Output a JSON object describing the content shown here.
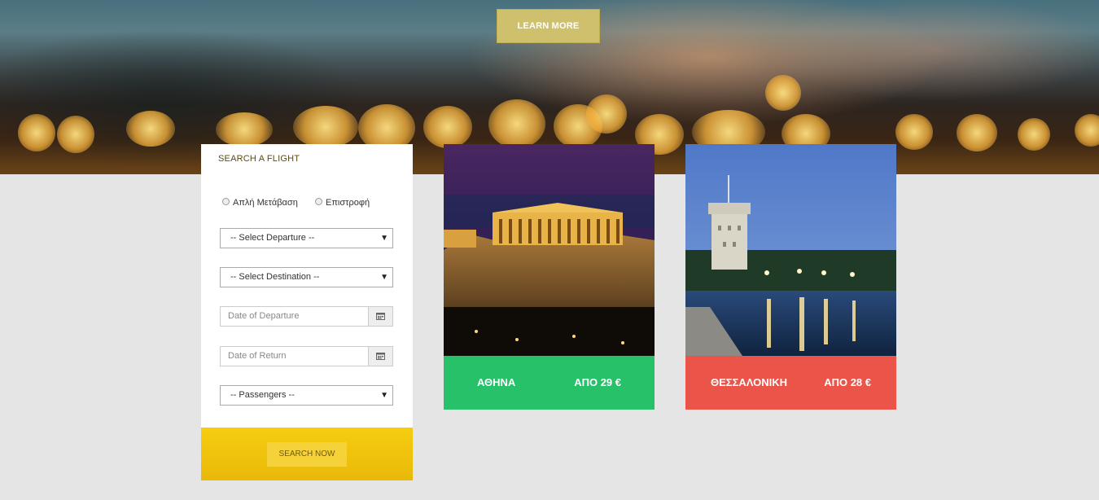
{
  "hero": {
    "learn_more_label": "LEARN MORE"
  },
  "search": {
    "title": "SEARCH A FLIGHT",
    "trip_types": [
      "Απλή Μετάβαση",
      "Επιστροφή"
    ],
    "departure_select": "-- Select Departure --",
    "destination_select": "-- Select Destination --",
    "departure_date_placeholder": "Date of Departure",
    "return_date_placeholder": "Date of Return",
    "passengers_select": "-- Passengers --",
    "submit_label": "SEARCH NOW"
  },
  "destinations": [
    {
      "name": "ΑΘΗΝΑ",
      "price": "ΑΠΟ 29 €",
      "color": "#27c16a"
    },
    {
      "name": "ΘΕΣΣΑΛΟΝΙΚΗ",
      "price": "ΑΠΟ 28 €",
      "color": "#ea5449"
    }
  ],
  "icons": [
    "calendar-icon",
    "dropdown-arrow-icon",
    "radio-icon"
  ]
}
